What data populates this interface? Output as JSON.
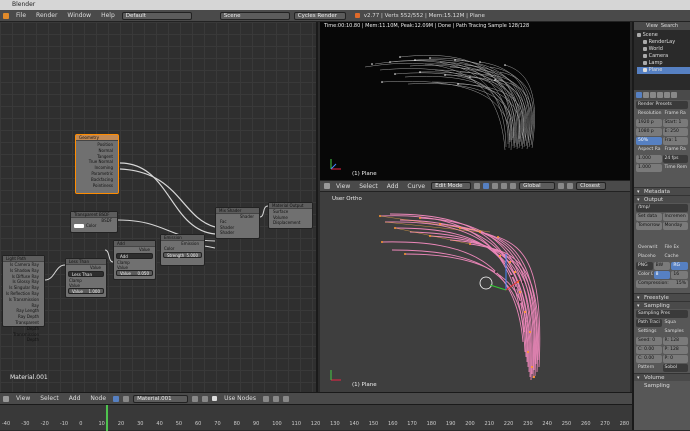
{
  "window": {
    "title": "Blender"
  },
  "topbar": {
    "menus": [
      "File",
      "Render",
      "Window",
      "Help"
    ],
    "layout": "Default",
    "scene": "Scene",
    "engine": "Cycles Render",
    "stats": "v2.77 | Verts 552/552 | Mem:15.12M | Plane"
  },
  "node_editor": {
    "material_label": "Material.001",
    "nodes": {
      "geometry": {
        "title": "Geometry",
        "outputs": [
          "Position",
          "Normal",
          "Tangent",
          "True Normal",
          "Incoming",
          "Parametric",
          "Backfacing",
          "Pointiness"
        ]
      },
      "transparent": {
        "title": "Transparent BSDF",
        "output": "BSDF",
        "input": "Color"
      },
      "add": {
        "title": "Add",
        "output": "Value",
        "mode": "Add",
        "clamp": "Clamp",
        "in_label": "Value",
        "in_value": "0.050"
      },
      "emission": {
        "title": "Emission",
        "output": "Emission",
        "in_color": "Color",
        "strength_label": "Strength",
        "strength_value": "5.000"
      },
      "mix": {
        "title": "Mix Shader",
        "output": "Shader",
        "inputs": [
          "Fac",
          "Shader",
          "Shader"
        ]
      },
      "matout": {
        "title": "Material Output",
        "inputs": [
          "Surface",
          "Volume",
          "Displacement"
        ]
      },
      "lightpath": {
        "title": "Light Path",
        "outputs": [
          "Is Camera Ray",
          "Is Shadow Ray",
          "Is Diffuse Ray",
          "Is Glossy Ray",
          "Is Singular Ray",
          "Is Reflection Ray",
          "Is Transmission Ray",
          "Ray Length",
          "Ray Depth",
          "Transparent Depth",
          "Transmission Depth"
        ]
      },
      "lessthan": {
        "title": "Less Than",
        "output": "Value",
        "mode": "Less Than",
        "clamp": "Clamp",
        "in_label": "Value",
        "in_value": "1.000"
      }
    }
  },
  "viewport_top": {
    "status": "Time:00:10.80 | Mem:11.10M, Peak:12.09M | Done | Path Tracing Sample 128/128",
    "object_label": "(1) Plane"
  },
  "viewport_header": {
    "items": [
      "View",
      "Select",
      "Add",
      "Curve"
    ],
    "mode": "Edit Mode",
    "orientation": "Global",
    "snap": "Closest"
  },
  "viewport_bot": {
    "label": "User Ortho",
    "object_label": "(1) Plane"
  },
  "outliner": {
    "tabs": [
      "View",
      "Search"
    ],
    "items": [
      "Scene",
      "RenderLay",
      "World",
      "Camera",
      "Lamp",
      "Plane"
    ]
  },
  "properties": {
    "render_presets": "Render Presets",
    "resolution": {
      "label": "Resolution:",
      "x": "1920 p",
      "y": "1080 p",
      "pct": "50%"
    },
    "frame_range": {
      "label": "Frame Ra",
      "start": "Start: 1",
      "end": "E: 250",
      "fra": "Fra: 1"
    },
    "aspect": {
      "label": "Aspect Ra",
      "x": "1.000",
      "y": "1.000"
    },
    "frame_rate": {
      "label": "Frame Ra",
      "fps": "24 fps",
      "time_label": "Time Rem"
    },
    "panels": [
      "Metadata",
      "Output",
      "Freestyle",
      "Sampling",
      "Volume Sampling"
    ],
    "output": {
      "path": "/tmp/",
      "set_data": "Set data",
      "incremental": "Incremen",
      "tomorrow": "Tomorrow",
      "monday": "Monday",
      "overwrite": "Overwrit",
      "file_ext": "File Ex",
      "placeholders": "Placeho",
      "cache": "Cache",
      "format": "PNG",
      "bw": "BW",
      "rgb": "RG",
      "color_depth": "Color D",
      "cd8": "8",
      "cd16": "16",
      "compression": "Compression:",
      "comp_val": "15%"
    },
    "sampling": {
      "presets": "Sampling Pres",
      "pattern_label": "Path Traci",
      "square": "Squa",
      "settings": "Settings",
      "samples": "Samples",
      "seed": "Seed: 0",
      "render": "R: 128",
      "clamp_d": "C: 0.00",
      "preview": "P: 128",
      "clamp_i": "C: 0.00",
      "p2": "P: 0",
      "pattern": "Pattern",
      "sobol": "Sobol"
    }
  },
  "bottom_header": {
    "items": [
      "View",
      "Select",
      "Add",
      "Node"
    ],
    "material": "Material.001",
    "use_nodes": "Use Nodes"
  },
  "timeline": {
    "ticks": [
      "-40",
      "-30",
      "-20",
      "-10",
      "0",
      "10",
      "20",
      "30",
      "40",
      "50",
      "60",
      "70",
      "80",
      "90",
      "100",
      "110",
      "120",
      "130",
      "140",
      "150",
      "160",
      "170",
      "180",
      "190",
      "200",
      "210",
      "220",
      "230",
      "240",
      "250",
      "260",
      "270",
      "280"
    ]
  },
  "colors": {
    "accent": "#5680c2",
    "node_selected": "#ff8c00",
    "vertex": "#ff9933",
    "curve": "#ff8fc7"
  }
}
